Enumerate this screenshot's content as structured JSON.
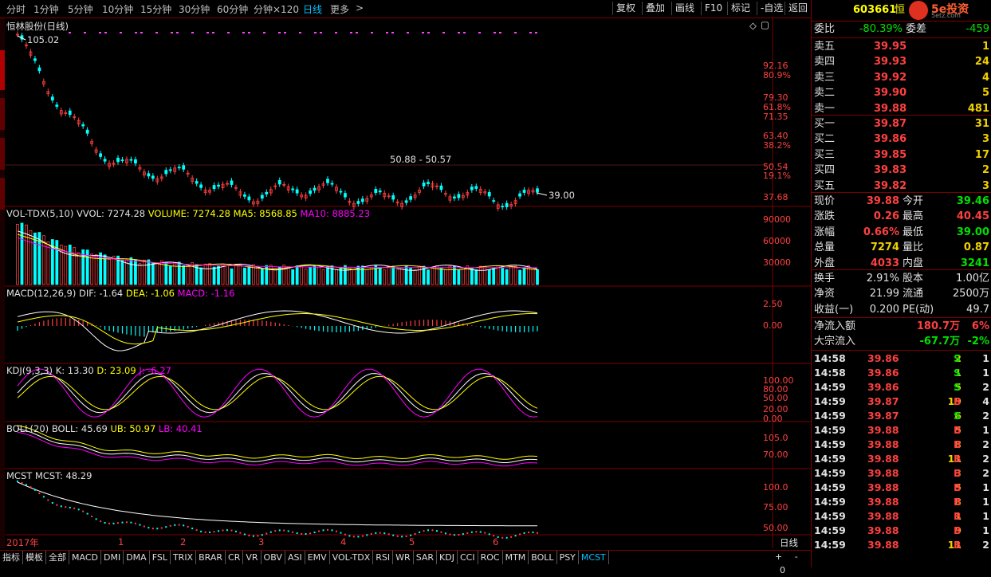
{
  "toolbar": {
    "periods": [
      "分时",
      "1分钟",
      "5分钟",
      "10分钟",
      "15分钟",
      "30分钟",
      "60分钟",
      "分钟×120",
      "日线",
      "更多"
    ],
    "active_period": "日线",
    "more_arrow": ">",
    "buttons": [
      "复权",
      "叠加",
      "画线",
      "F10",
      "标记",
      "-自选",
      "返回"
    ]
  },
  "chart": {
    "title": "恒林股份(日线)",
    "high_mark": "105.02",
    "low_mark": "39.00",
    "range_label": "50.88 - 50.57",
    "price_axis": [
      {
        "v": "92.16",
        "c": "#ff4040"
      },
      {
        "v": "80.9%",
        "c": "#ff4040"
      },
      {
        "v": "79.30",
        "c": "#ff4040"
      },
      {
        "v": "61.8%",
        "c": "#ff4040"
      },
      {
        "v": "71.35",
        "c": "#ff4040"
      },
      {
        "v": "63.40",
        "c": "#ff4040"
      },
      {
        "v": "38.2%",
        "c": "#ff4040"
      },
      {
        "v": "50.54",
        "c": "#ff4040"
      },
      {
        "v": "19.1%",
        "c": "#ff4040"
      },
      {
        "v": "37.68",
        "c": "#ff4040"
      }
    ],
    "vol": {
      "label": "VOL-TDX(5,10)",
      "vvol": "VVOL: 7274.28",
      "volume": "VOLUME: 7274.28",
      "ma5": "MA5: 8568.85",
      "ma10": "MA10: 8885.23",
      "axis": [
        "90000",
        "60000",
        "30000"
      ]
    },
    "macd": {
      "label": "MACD(12,26,9)",
      "dif": "DIF: -1.64",
      "dea": "DEA: -1.06",
      "macd": "MACD: -1.16",
      "axis": [
        "2.50",
        "0.00"
      ]
    },
    "kdj": {
      "label": "KDJ(9,3,3)",
      "k": "K: 13.30",
      "d": "D: 23.09",
      "j": "J: -6.27",
      "axis": [
        "100.00",
        "80.00",
        "50.00",
        "20.00",
        "0.00"
      ]
    },
    "boll": {
      "label": "BOLL(20)",
      "boll": "BOLL: 45.69",
      "ub": "UB: 50.97",
      "lb": "LB: 40.41",
      "axis": [
        "105.0",
        "70.00"
      ]
    },
    "mcst": {
      "label": "MCST",
      "mcst": "MCST: 48.29",
      "axis": [
        "100.0",
        "75.00",
        "50.00"
      ]
    },
    "date_axis": [
      "2017年",
      "1",
      "2",
      "3",
      "4",
      "5",
      "6"
    ],
    "period_label": "日线",
    "zoom": [
      "+",
      "-",
      "0"
    ]
  },
  "tabs": [
    "指标",
    "模板",
    "全部",
    "MACD",
    "DMI",
    "DMA",
    "FSL",
    "TRIX",
    "BRAR",
    "CR",
    "VR",
    "OBV",
    "ASI",
    "EMV",
    "VOL-TDX",
    "RSI",
    "WR",
    "SAR",
    "KDJ",
    "CCI",
    "ROC",
    "MTM",
    "BOLL",
    "PSY",
    "MCST"
  ],
  "active_tab": "MCST",
  "panel": {
    "code": "603661",
    "name": "恒",
    "brand": "5e投资",
    "brand_url": "5etz.com",
    "webi_label": "委比",
    "webi_value": "-80.39%",
    "weicha_label": "委差",
    "weicha_value": "-459",
    "asks": [
      {
        "label": "卖五",
        "price": "39.95",
        "vol": "1"
      },
      {
        "label": "卖四",
        "price": "39.93",
        "vol": "24"
      },
      {
        "label": "卖三",
        "price": "39.92",
        "vol": "4"
      },
      {
        "label": "卖二",
        "price": "39.90",
        "vol": "5"
      },
      {
        "label": "卖一",
        "price": "39.88",
        "vol": "481"
      }
    ],
    "bids": [
      {
        "label": "买一",
        "price": "39.87",
        "vol": "31"
      },
      {
        "label": "买二",
        "price": "39.86",
        "vol": "3"
      },
      {
        "label": "买三",
        "price": "39.85",
        "vol": "17"
      },
      {
        "label": "买四",
        "price": "39.83",
        "vol": "2"
      },
      {
        "label": "买五",
        "price": "39.82",
        "vol": "3"
      }
    ],
    "quote": [
      {
        "l1": "现价",
        "v1": "39.88",
        "c1": "red",
        "l2": "今开",
        "v2": "39.46",
        "c2": "grn"
      },
      {
        "l1": "涨跌",
        "v1": "0.26",
        "c1": "red",
        "l2": "最高",
        "v2": "40.45",
        "c2": "red"
      },
      {
        "l1": "涨幅",
        "v1": "0.66%",
        "c1": "red",
        "l2": "最低",
        "v2": "39.00",
        "c2": "grn"
      },
      {
        "l1": "总量",
        "v1": "7274",
        "c1": "yel",
        "l2": "量比",
        "v2": "0.87",
        "c2": "yel"
      },
      {
        "l1": "外盘",
        "v1": "4033",
        "c1": "red",
        "l2": "内盘",
        "v2": "3241",
        "c2": "grn"
      }
    ],
    "stats": [
      {
        "l1": "换手",
        "v1": "2.91%",
        "l2": "股本",
        "v2": "1.00亿"
      },
      {
        "l1": "净资",
        "v1": "21.99",
        "l2": "流通",
        "v2": "2500万"
      },
      {
        "l1": "收益(一)",
        "v1": "0.200",
        "l2": "PE(动)",
        "v2": "49.7"
      }
    ],
    "flows": [
      {
        "label": "净流入额",
        "value": "180.7万",
        "pct": "6%",
        "c": "red"
      },
      {
        "label": "大宗流入",
        "value": "-67.7万",
        "pct": "-2%",
        "c": "grn"
      }
    ],
    "ticks": [
      {
        "t": "14:58",
        "p": "39.86",
        "v": "2",
        "s": "S",
        "n": "1"
      },
      {
        "t": "14:58",
        "p": "39.86",
        "v": "1",
        "s": "S",
        "n": "1"
      },
      {
        "t": "14:59",
        "p": "39.86",
        "v": "5",
        "s": "S",
        "n": "2"
      },
      {
        "t": "14:59",
        "p": "39.87",
        "v": "19",
        "s": "B",
        "n": "4"
      },
      {
        "t": "14:59",
        "p": "39.87",
        "v": "6",
        "s": "S",
        "n": "2"
      },
      {
        "t": "14:59",
        "p": "39.88",
        "v": "5",
        "s": "B",
        "n": "1"
      },
      {
        "t": "14:59",
        "p": "39.88",
        "v": "8",
        "s": "B",
        "n": "2"
      },
      {
        "t": "14:59",
        "p": "39.88",
        "v": "11",
        "s": "B",
        "n": "2"
      },
      {
        "t": "14:59",
        "p": "39.88",
        "v": "3",
        "s": "B",
        "n": "2"
      },
      {
        "t": "14:59",
        "p": "39.88",
        "v": "5",
        "s": "B",
        "n": "1"
      },
      {
        "t": "14:59",
        "p": "39.88",
        "v": "8",
        "s": "B",
        "n": "1"
      },
      {
        "t": "14:59",
        "p": "39.88",
        "v": "1",
        "s": "B",
        "n": "1"
      },
      {
        "t": "14:59",
        "p": "39.88",
        "v": "9",
        "s": "B",
        "n": "1"
      },
      {
        "t": "14:59",
        "p": "39.88",
        "v": "11",
        "s": "B",
        "n": "2"
      }
    ]
  },
  "colors": {
    "up": "#ff4040",
    "down": "#00ffff",
    "accent": "#00c0ff",
    "frame": "#7a0000",
    "ma_white": "#ffffff",
    "ma_yellow": "#ffff00",
    "ma_magenta": "#ff00ff"
  }
}
